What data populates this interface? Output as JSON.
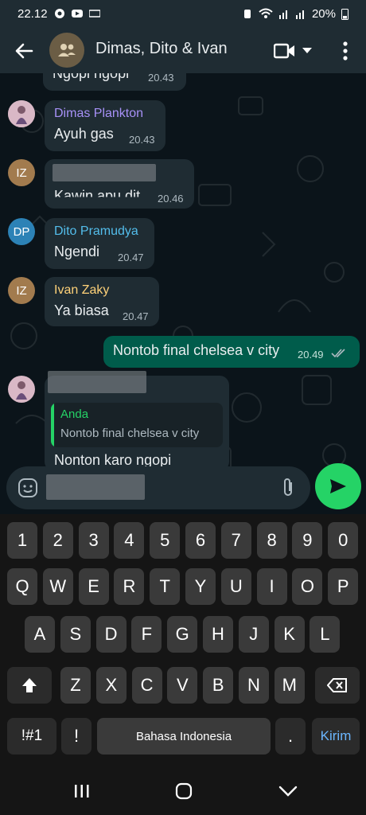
{
  "status_bar": {
    "time": "22.12",
    "battery": "20%"
  },
  "header": {
    "title": "Dimas, Dito & Ivan"
  },
  "messages": [
    {
      "text": "Ngopi ngopi",
      "time": "20.43"
    },
    {
      "sender": "Dimas Plankton",
      "sender_color": "#a791f7",
      "text": "Ayuh gas",
      "time": "20.43"
    },
    {
      "avatar": "IZ",
      "text": "Kawin apu dit",
      "time": "20.46"
    },
    {
      "avatar": "DP",
      "sender": "Dito Pramudya",
      "sender_color": "#53bdeb",
      "text": "Ngendi",
      "time": "20.47"
    },
    {
      "avatar": "IZ",
      "sender": "Ivan Zaky",
      "sender_color": "#ffd279",
      "text": "Ya biasa",
      "time": "20.47"
    },
    {
      "text": "Nontob final chelsea v city",
      "time": "20.49"
    },
    {
      "quote_author": "Anda",
      "quote_text": "Nontob final chelsea v city",
      "text": "Nonton karo ngopi"
    }
  ],
  "keyboard": {
    "row1": [
      "1",
      "2",
      "3",
      "4",
      "5",
      "6",
      "7",
      "8",
      "9",
      "0"
    ],
    "row2": [
      "Q",
      "W",
      "E",
      "R",
      "T",
      "Y",
      "U",
      "I",
      "O",
      "P"
    ],
    "row3": [
      "A",
      "S",
      "D",
      "F",
      "G",
      "H",
      "J",
      "K",
      "L"
    ],
    "row4": [
      "Z",
      "X",
      "C",
      "V",
      "B",
      "N",
      "M"
    ],
    "symbols": "!#1",
    "exclaim": "!",
    "space": "Bahasa Indonesia",
    "period": ".",
    "enter": "Kirim"
  },
  "colors": {
    "accent": "#25d366",
    "outgoing": "#005c4b",
    "incoming": "#1f2c33",
    "read_ticks": "#53bdeb"
  }
}
